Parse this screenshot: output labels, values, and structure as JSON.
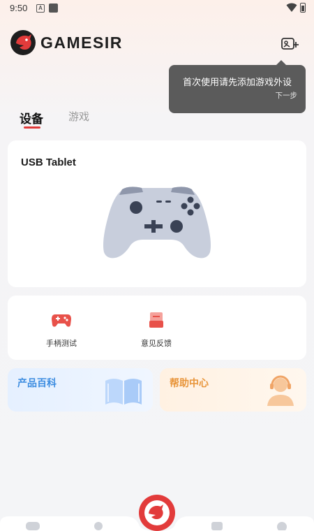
{
  "status_bar": {
    "time": "9:50",
    "notification_letter": "A"
  },
  "header": {
    "brand": "GAMESIR"
  },
  "tooltip": {
    "text": "首次使用请先添加游戏外设",
    "next": "下一步"
  },
  "tabs": [
    {
      "label": "设备",
      "active": true
    },
    {
      "label": "游戏",
      "active": false
    }
  ],
  "device_card": {
    "name": "USB Tablet"
  },
  "tools": [
    {
      "label": "手柄测试",
      "icon": "gamepad-icon"
    },
    {
      "label": "意见反馈",
      "icon": "feedback-icon"
    }
  ],
  "cards": {
    "wiki": {
      "title": "产品百科",
      "icon": "book-icon"
    },
    "help": {
      "title": "帮助中心",
      "icon": "headset-icon"
    }
  },
  "colors": {
    "accent": "#e03a3a",
    "wiki_blue": "#3c8ce0",
    "help_orange": "#e8953a"
  }
}
